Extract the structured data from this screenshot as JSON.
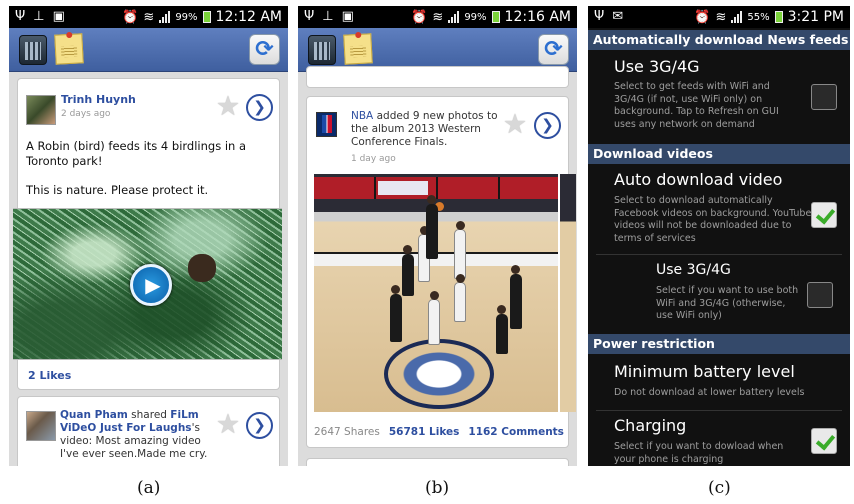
{
  "panel_a": {
    "status": {
      "battery": "99%",
      "time": "12:12 AM"
    },
    "post1": {
      "author": "Trinh Huynh",
      "time": "2 days ago",
      "text1": "A Robin (bird) feeds its 4 birdlings in a Toronto park!",
      "text2": "This is nature. Please protect it.",
      "likes": "2 Likes"
    },
    "post2": {
      "author": "Quan Pham",
      "shared": "shared",
      "link": "FiLm ViDeO Just For Laughs",
      "suffix": "'s video: Most amazing video I've ever seen.Made me cry."
    },
    "caption": "(a)"
  },
  "panel_b": {
    "status": {
      "battery": "99%",
      "time": "12:16 AM"
    },
    "post": {
      "author": "NBA",
      "action": "added 9 new photos to the album 2013 Western Conference Finals.",
      "time": "1 day ago",
      "shares": "2647 Shares",
      "likes": "56781 Likes",
      "comments": "1162 Comments"
    },
    "caption": "(b)"
  },
  "panel_c": {
    "status": {
      "battery": "55%",
      "time": "3:21 PM"
    },
    "section1": "Automatically download News feeds",
    "opt1": {
      "title": "Use 3G/4G",
      "desc": "Select to get feeds with WiFi and 3G/4G (if not, use WiFi only) on background. Tap to Refresh on GUI uses any network on demand",
      "checked": false
    },
    "section2": "Download videos",
    "opt2": {
      "title": "Auto download video",
      "desc": "Select to download automatically Facebook videos on background. YouTube videos will not be downloaded due to terms of services",
      "checked": true
    },
    "opt3": {
      "title": "Use 3G/4G",
      "desc": "Select if you want to use both WiFi and 3G/4G (otherwise, use WiFi only)",
      "checked": false
    },
    "section3": "Power restriction",
    "opt4": {
      "title": "Minimum battery level",
      "desc": "Do not download at lower battery levels"
    },
    "opt5": {
      "title": "Charging",
      "desc": "Select if you want to dowload when your phone is charging",
      "checked": true
    },
    "caption": "(c)"
  },
  "icons": [
    "usb-icon",
    "upload-icon",
    "gallery-icon",
    "alarm-icon",
    "wifi-icon",
    "signal-icon",
    "battery-icon",
    "app-logo-icon",
    "sticky-note-icon",
    "refresh-icon",
    "star-icon",
    "chevron-right-icon",
    "play-icon",
    "checkbox-icon"
  ]
}
